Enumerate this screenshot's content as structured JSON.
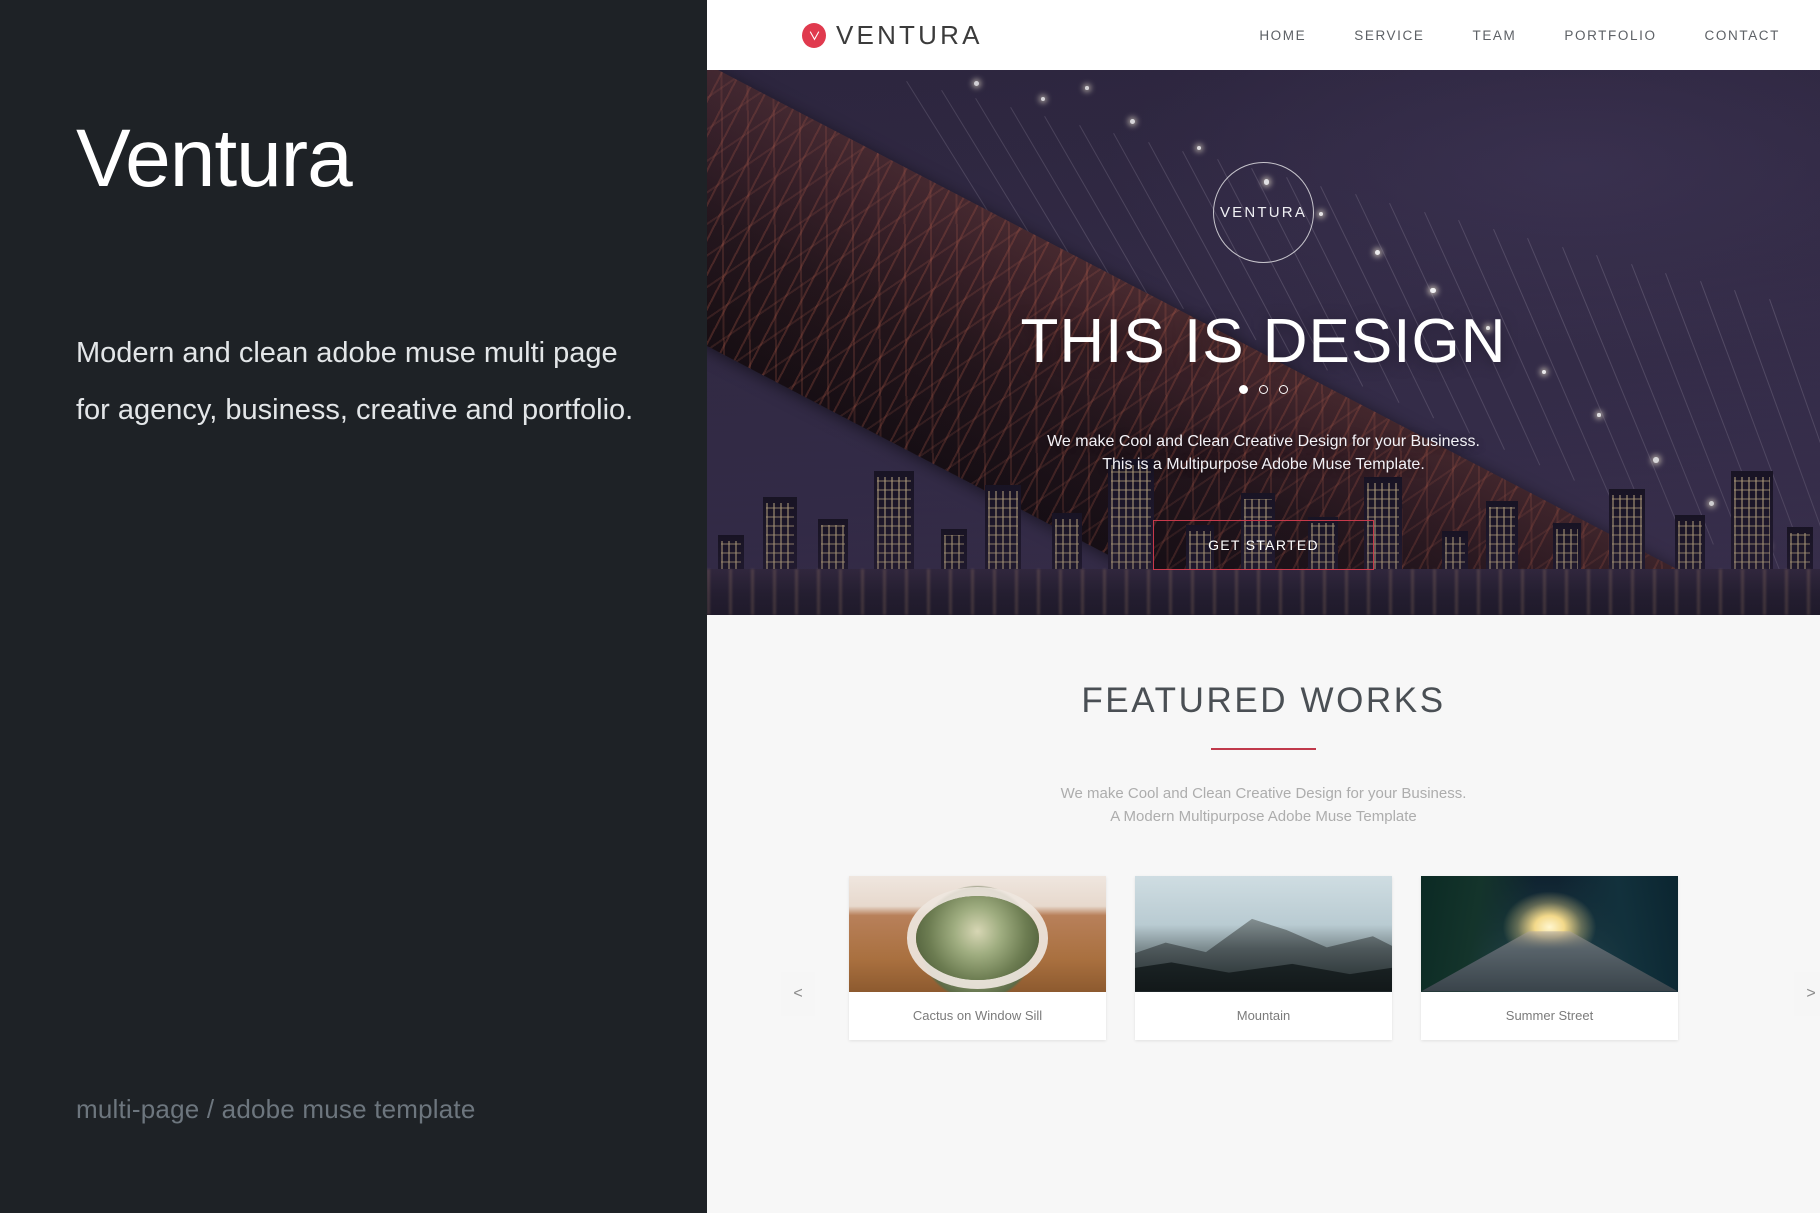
{
  "promo": {
    "title": "Ventura",
    "description": "Modern and clean adobe muse multi page for agency, business, creative and portfolio.",
    "tagline": "multi-page / adobe muse template"
  },
  "colors": {
    "panel_background": "#1e2226",
    "accent_red": "#e03a4e",
    "divider_red": "#c0394b",
    "hero_overlay": "#2e2740",
    "works_background": "#f7f7f7"
  },
  "site": {
    "header": {
      "logo_icon": "ventura-v-mark-icon",
      "brand": "VENTURA",
      "nav": [
        {
          "label": "HOME"
        },
        {
          "label": "SERVICE"
        },
        {
          "label": "TEAM"
        },
        {
          "label": "PORTFOLIO"
        },
        {
          "label": "CONTACT"
        }
      ]
    },
    "hero": {
      "badge": "VENTURA",
      "title": "THIS IS DESIGN",
      "subtitle_line1": "We make Cool and Clean Creative Design for your Business.",
      "subtitle_line2": "This is a Multipurpose Adobe Muse Template.",
      "cta": "GET STARTED",
      "slides": 3,
      "active_slide": 1
    },
    "works": {
      "title": "FEATURED WORKS",
      "subtitle_line1": "We make Cool and Clean Creative Design for your Business.",
      "subtitle_line2": "A Modern Multipurpose Adobe Muse Template",
      "prev_label": "<",
      "next_label": ">",
      "cards": [
        {
          "caption": "Cactus on Window Sill",
          "image": "cactus-photo"
        },
        {
          "caption": "Mountain",
          "image": "mountain-photo"
        },
        {
          "caption": "Summer Street",
          "image": "summer-street-photo"
        }
      ]
    }
  }
}
